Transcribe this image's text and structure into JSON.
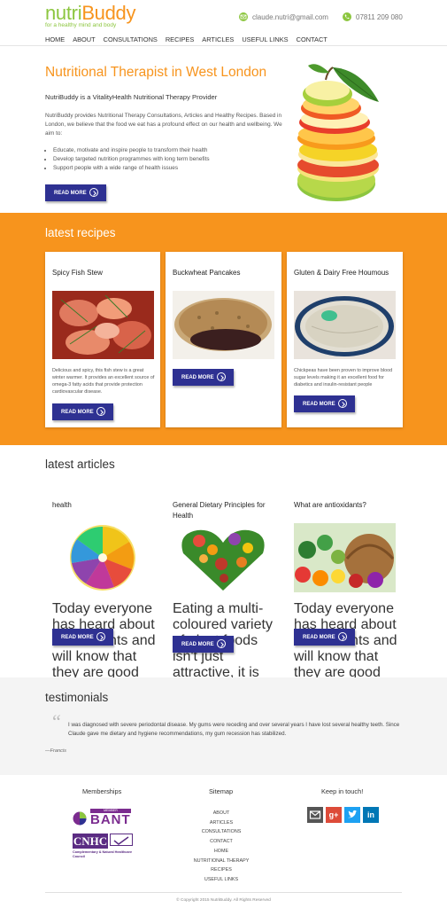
{
  "header": {
    "logo_part1": "nutri",
    "logo_part2": "Buddy",
    "tagline": "for a healthy mind and body",
    "email": "claude.nutri@gmail.com",
    "phone": "07811 209 080"
  },
  "nav": {
    "items": [
      "HOME",
      "ABOUT",
      "CONSULTATIONS",
      "RECIPES",
      "ARTICLES",
      "USEFUL LINKS",
      "CONTACT"
    ]
  },
  "hero": {
    "title": "Nutritional Therapist in West London",
    "subtitle": "NutriBuddy is a VitalityHealth Nutritional Therapy Provider",
    "description": "NutriBuddy provides Nutritional Therapy Consultations, Articles and Healthy Recipes. Based in London, we believe that the food we eat has a profound effect on our health and wellbeing. We aim to:",
    "bullets": [
      "Educate, motivate and inspire people to transform their health",
      "Develop targeted nutrition programmes with long term benefits",
      "Support people with a wide range of health issues"
    ],
    "button": "READ MORE"
  },
  "recipes": {
    "title": "latest recipes",
    "items": [
      {
        "title": "Spicy Fish Stew",
        "text": "Delicious and spicy, this fish stew is a great winter warmer. It provides an excellent source of omega-3 fatty acids that provide protection cardiovascular disease.",
        "button": "READ MORE"
      },
      {
        "title": "Buckwheat Pancakes",
        "text": "",
        "button": "READ MORE"
      },
      {
        "title": "Gluten & Dairy Free Houmous",
        "text": "Chickpeas have been proven to improve blood sugar levels making it an excellent food for diabetics and insulin-resistant people",
        "button": "READ MORE"
      }
    ]
  },
  "articles": {
    "title": "latest articles",
    "items": [
      {
        "title": "health",
        "text": "Today everyone has heard about antioxidants and will know that they are good for us, but why? and what are they?",
        "button": "READ MORE"
      },
      {
        "title": "General Dietary Principles for Health",
        "text": "Eating a multi-coloured variety of plant foods isn't just attractive, it is good for you. Each colour relates to a different plant chemical, each with particular health benefits.",
        "button": "READ MORE"
      },
      {
        "title": "What are antioxidants?",
        "text": "Today everyone has heard about antioxidants and will know that they are good for us, but why? and what are they?",
        "button": "READ MORE"
      }
    ]
  },
  "testimonials": {
    "title": "testimonials",
    "quote": "I was diagnosed with severe periodontal disease. My gums were receding and over several years I have lost several healthy teeth. Since Claude gave me dietary and hygiene recommendations, my gum recession has stabilized.",
    "author": "—Francis"
  },
  "footer": {
    "memberships_title": "Memberships",
    "bant_label": "BANT",
    "bant_member": "MEMBER",
    "cnhc_label": "CNHC",
    "cnhc_text": "Complementary & Natural Healthcare Council",
    "sitemap_title": "Sitemap",
    "sitemap_links": [
      "ABOUT",
      "ARTICLES",
      "CONSULTATIONS",
      "CONTACT",
      "HOME",
      "NUTRITIONAL THERAPY",
      "RECIPES",
      "USEFUL LINKS"
    ],
    "keep_in_touch_title": "Keep in touch!",
    "social": [
      "email-icon",
      "google-plus-icon",
      "twitter-icon",
      "linkedin-icon"
    ],
    "copyright": "© Copyright 2015 NutriBuddy. All Rights Reserved"
  },
  "colors": {
    "orange": "#f7941d",
    "green": "#8cc63f",
    "navy": "#2e3192"
  }
}
